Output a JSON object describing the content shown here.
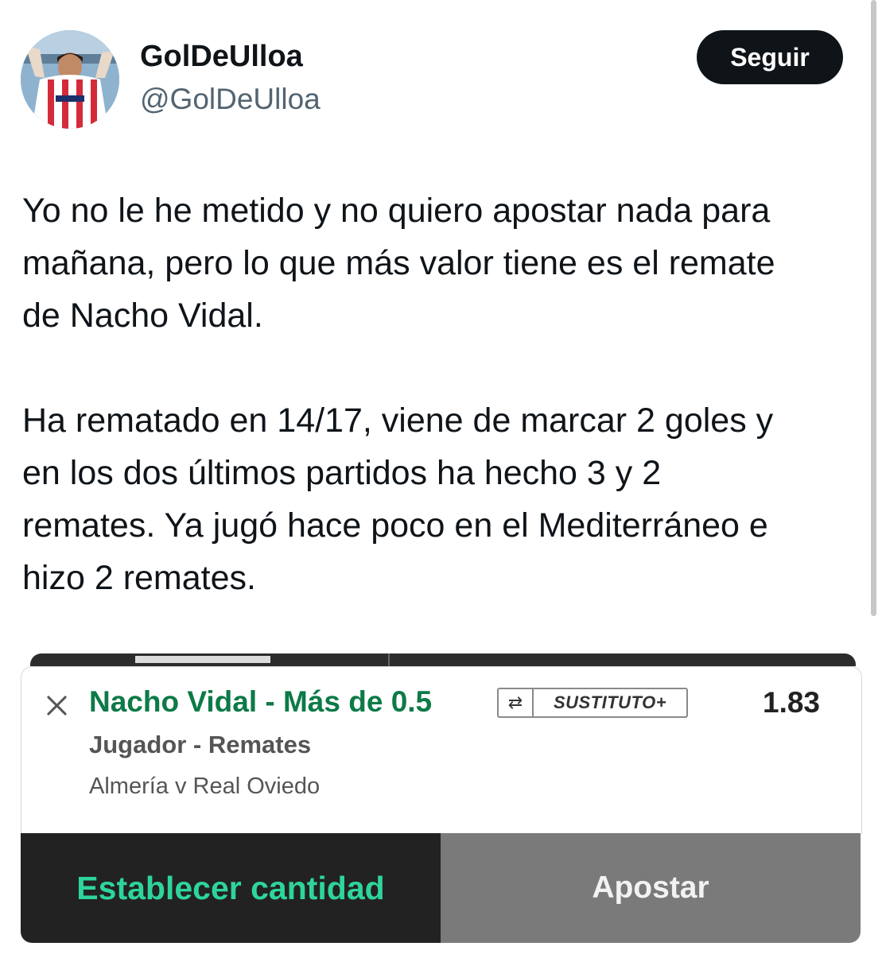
{
  "author": {
    "display_name": "GolDeUlloa",
    "handle": "@GolDeUlloa",
    "avatar_icon": "profile-photo"
  },
  "follow_button": {
    "label": "Seguir"
  },
  "tweet": {
    "paragraphs": [
      "Yo no le he metido y no quiero apostar nada para\nmañana, pero lo que más valor tiene es el remate\nde Nacho Vidal.",
      "Ha rematado en 14/17, viene de marcar 2 goles y\nen los dos últimos partidos ha hecho 3 y 2\nremates. Ya jugó hace poco en el Mediterráneo e\nhizo 2 remates."
    ]
  },
  "bet_slip": {
    "selection": "Nacho Vidal - Más de 0.5",
    "badge": {
      "icon": "swap-icon",
      "label": "SUSTITUTO+"
    },
    "odds": "1.83",
    "market": "Jugador - Remates",
    "event": "Almería v Real Oviedo",
    "stake_button": "Establecer cantidad",
    "place_button": "Apostar",
    "colors": {
      "selection": "#0d7a47",
      "stake_text": "#2ed59a",
      "stake_bg": "#222222",
      "place_bg": "#7a7a7a"
    }
  }
}
